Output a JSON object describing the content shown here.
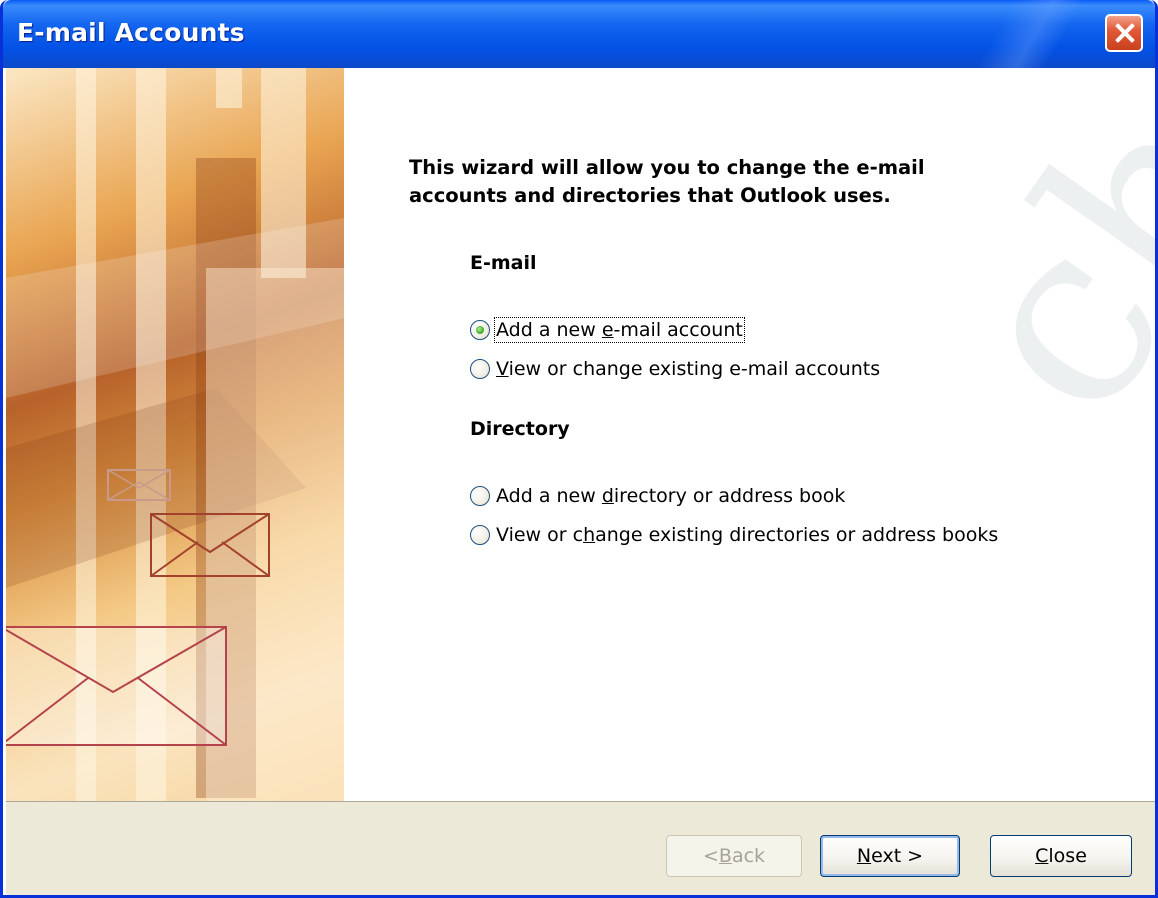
{
  "window": {
    "title": "E-mail Accounts"
  },
  "wizard": {
    "heading": "This wizard will allow you to change the e-mail accounts and directories that Outlook uses.",
    "email_section": {
      "title": "E-mail",
      "options": [
        {
          "before": "Add a new ",
          "accel": "e",
          "after": "-mail account",
          "checked": true
        },
        {
          "before": "",
          "accel": "V",
          "after": "iew or change existing e-mail accounts",
          "checked": false
        }
      ]
    },
    "directory_section": {
      "title": "Directory",
      "options": [
        {
          "before": "Add a new ",
          "accel": "d",
          "after": "irectory or address book",
          "checked": false
        },
        {
          "before": "View or c",
          "accel": "h",
          "after": "ange existing directories or address books",
          "checked": false
        }
      ]
    }
  },
  "buttons": {
    "back": {
      "before": "< ",
      "accel": "B",
      "after": "ack",
      "enabled": false
    },
    "next": {
      "before": "",
      "accel": "N",
      "after": "ext >",
      "enabled": true
    },
    "close": {
      "before": "",
      "accel": "C",
      "after": "lose",
      "enabled": true
    }
  },
  "watermark": "chnology",
  "icons": {
    "close_window": "close-x-icon",
    "envelopes": "envelope-icon"
  },
  "colors": {
    "titlebar": "#0a59f7",
    "close_button": "#e25a3a",
    "radio_checked": "#21a121",
    "button_bar": "#ece9d8"
  }
}
